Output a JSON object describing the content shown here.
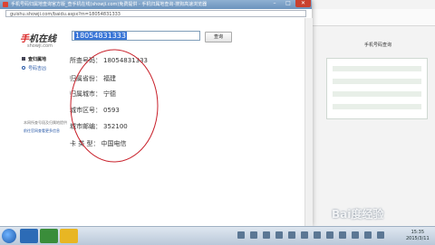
{
  "window": {
    "title": "手机号码归属地查询官方版_查手机在线(showji.com)免费提供 - 手机归属地查询-搜狗高速浏览器",
    "url": "guishu.showji.com/baidu.aspx?m=18054831333"
  },
  "logo": {
    "main_a": "手",
    "main_b": "机在线",
    "sub": "showji.com"
  },
  "search": {
    "value": "18054831333",
    "button_label": "查询"
  },
  "sidebar": {
    "items": [
      {
        "label": "查归属地"
      },
      {
        "label": "号码吉凶"
      }
    ],
    "note_line1": "本网所查号段及归属地提供",
    "note_line2": "前往官网查看更多信息"
  },
  "results": [
    {
      "label": "所查号码：",
      "value": "18054831333"
    },
    {
      "label": "归属省份：",
      "value": "福建"
    },
    {
      "label": "归属城市：",
      "value": "宁德"
    },
    {
      "label": "城市区号：",
      "value": "0593"
    },
    {
      "label": "城市邮编：",
      "value": "352100"
    },
    {
      "label": "卡 类 型：",
      "value": "中国电信"
    }
  ],
  "background_page": {
    "text": "手机号码查询"
  },
  "taskbar": {
    "time": "15:35",
    "date": "2015/3/11"
  },
  "watermark": "Bai度经验",
  "colors": {
    "annotation_oval": "#c8202a",
    "selection": "#3875d7",
    "link": "#2a5aa8"
  }
}
